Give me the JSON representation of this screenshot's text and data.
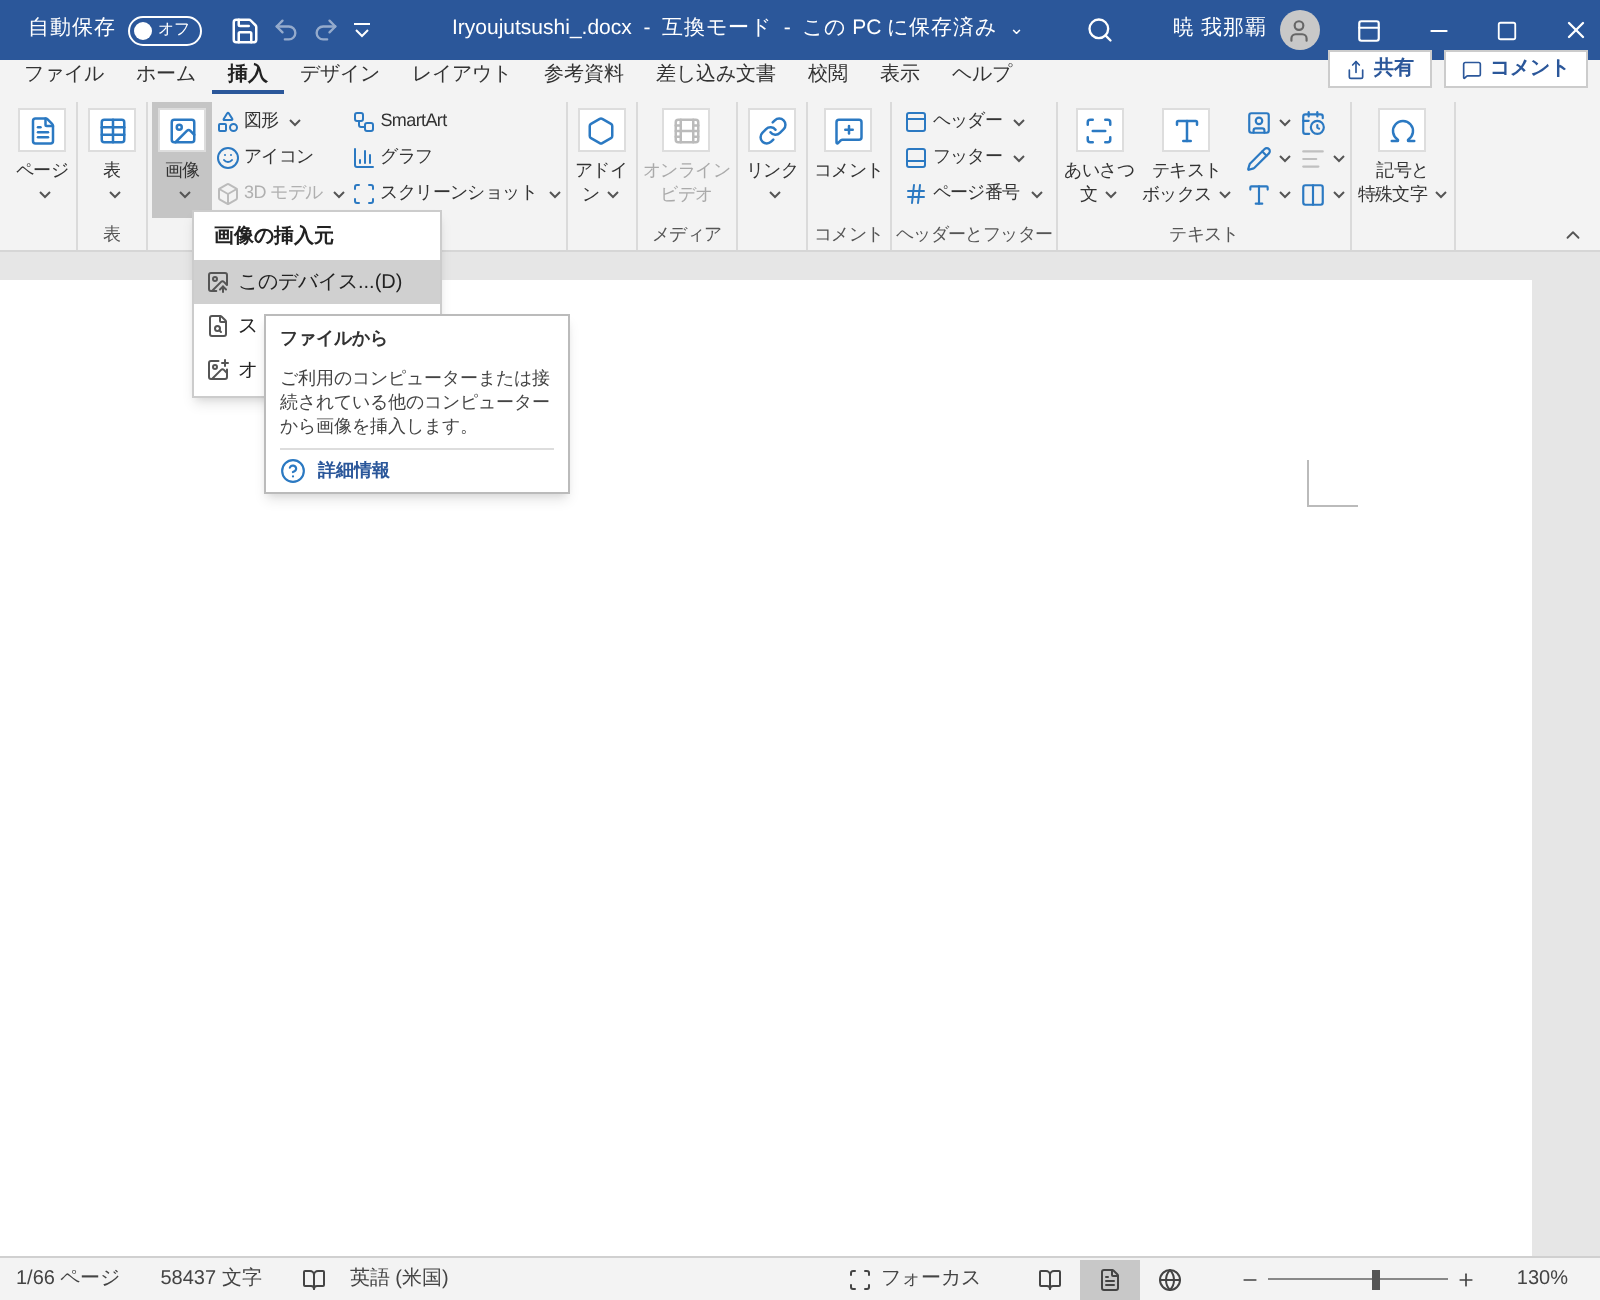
{
  "title_bar": {
    "autosave_label": "自動保存",
    "autosave": {
      "on": false,
      "label": "オフ"
    },
    "document_title": "Iryoujutsushi_.docx  -  互換モード  -  この PC に保存済み",
    "title_caret": "⌄",
    "user_name": "暁 我那覇"
  },
  "tabs": [
    {
      "label": "ファイル",
      "selected": false
    },
    {
      "label": "ホーム",
      "selected": false
    },
    {
      "label": "挿入",
      "selected": true
    },
    {
      "label": "デザイン",
      "selected": false
    },
    {
      "label": "レイアウト",
      "selected": false
    },
    {
      "label": "参考資料",
      "selected": false
    },
    {
      "label": "差し込み文書",
      "selected": false
    },
    {
      "label": "校閲",
      "selected": false
    },
    {
      "label": "表示",
      "selected": false
    },
    {
      "label": "ヘルプ",
      "selected": false
    }
  ],
  "share_button": "共有",
  "comment_button": "コメント",
  "ribbon": {
    "groups": [
      {
        "large": [
          {
            "lines": [
              "ページ"
            ],
            "caret": true,
            "pressed": false,
            "disabled": false
          }
        ]
      },
      {
        "label": "表",
        "large": [
          {
            "lines": [
              "表"
            ],
            "caret": true,
            "pressed": false,
            "disabled": false
          }
        ]
      },
      {
        "large": [
          {
            "lines": [
              "画像"
            ],
            "caret": true,
            "pressed": true,
            "disabled": false
          }
        ],
        "small": [
          {
            "label": "図形",
            "caret": true,
            "disabled": false
          },
          {
            "label": "アイコン",
            "caret": false,
            "disabled": false
          },
          {
            "label": "3D モデル",
            "caret": true,
            "disabled": true
          },
          {
            "label": "SmartArt",
            "caret": false,
            "disabled": false
          },
          {
            "label": "グラフ",
            "caret": false,
            "disabled": false
          },
          {
            "label": "スクリーンショット",
            "caret": true,
            "disabled": false
          }
        ]
      },
      {
        "large": [
          {
            "lines": [
              "アドイ",
              "ン"
            ],
            "caret": true,
            "pressed": false,
            "disabled": false
          }
        ]
      },
      {
        "label": "メディア",
        "large": [
          {
            "lines": [
              "オンライン",
              "ビデオ"
            ],
            "caret": false,
            "pressed": false,
            "disabled": true
          }
        ]
      },
      {
        "large": [
          {
            "lines": [
              "リンク"
            ],
            "caret": true,
            "pressed": false,
            "disabled": false
          }
        ]
      },
      {
        "label": "コメント",
        "large": [
          {
            "lines": [
              "コメント"
            ],
            "caret": false,
            "pressed": false,
            "disabled": false
          }
        ]
      },
      {
        "label": "ヘッダーとフッター",
        "small": [
          {
            "label": "ヘッダー",
            "caret": true,
            "disabled": false
          },
          {
            "label": "フッター",
            "caret": true,
            "disabled": false
          },
          {
            "label": "ページ番号",
            "caret": true,
            "disabled": false
          }
        ]
      },
      {
        "label": "テキスト",
        "large": [
          {
            "lines": [
              "あいさつ",
              "文"
            ],
            "caret": true,
            "pressed": false,
            "disabled": false
          },
          {
            "lines": [
              "テキスト",
              "ボックス"
            ],
            "caret": true,
            "pressed": false,
            "disabled": false
          }
        ],
        "icons": [
          {
            "caret": true,
            "disabled": false
          },
          {
            "caret": true,
            "disabled": false
          },
          {
            "caret": true,
            "disabled": false
          },
          {
            "caret": false,
            "disabled": false
          },
          {
            "caret": true,
            "disabled": true
          },
          {
            "caret": true,
            "disabled": false
          }
        ]
      },
      {
        "large": [
          {
            "lines": [
              "記号と",
              "特殊文字"
            ],
            "caret": true,
            "pressed": false,
            "disabled": false
          }
        ]
      }
    ]
  },
  "picture_menu": {
    "header": "画像の挿入元",
    "items": [
      {
        "label": "このデバイス...(D)",
        "selected": true
      },
      {
        "label": "ス",
        "selected": false
      },
      {
        "label": "オ",
        "selected": false
      }
    ]
  },
  "tooltip": {
    "title": "ファイルから",
    "body": "ご利用のコンピューターまたは接続されている他のコンピューターから画像を挿入します。",
    "link": "詳細情報"
  },
  "status_bar": {
    "page": "1/66 ページ",
    "words": "58437 文字",
    "language": "英語 (米国)",
    "focus": "フォーカス",
    "views": [
      {
        "kind": "read",
        "selected": false
      },
      {
        "kind": "print",
        "selected": true
      },
      {
        "kind": "web",
        "selected": false
      }
    ],
    "zoom": {
      "level": 0.6,
      "label": "130%"
    }
  }
}
